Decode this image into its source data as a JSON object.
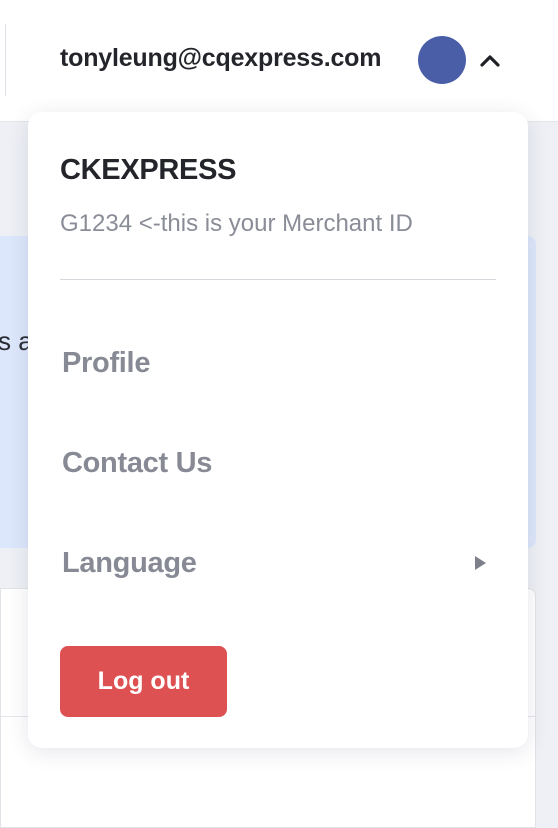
{
  "header": {
    "user_email": "tonyleung@cqexpress.com",
    "avatar_color": "#4a5ea8",
    "toggle_icon": "chevron-up-icon"
  },
  "background": {
    "banner_fragment": "s a"
  },
  "dropdown": {
    "company_name": "CKEXPRESS",
    "merchant_id_text": "G1234 <-this is your Merchant ID",
    "items": [
      {
        "label": "Profile"
      },
      {
        "label": "Contact Us"
      },
      {
        "label": "Language",
        "icon": "caret-right-icon"
      }
    ],
    "logout_label": "Log out",
    "logout_color": "#de5153"
  }
}
